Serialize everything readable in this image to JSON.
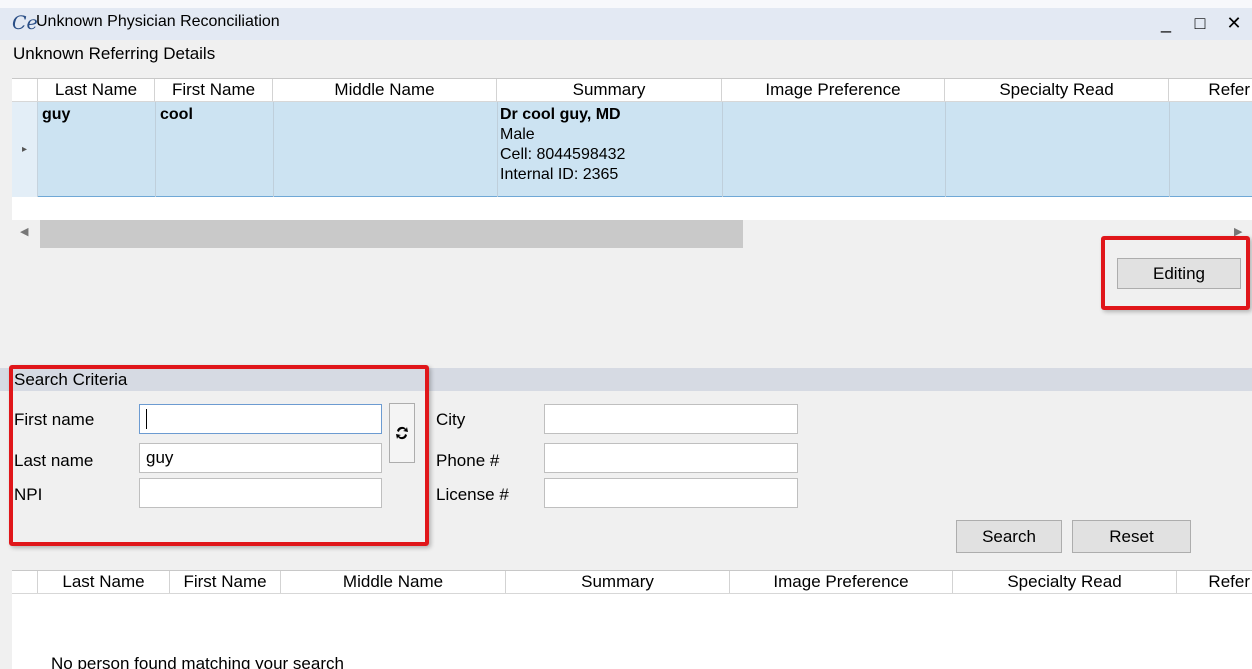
{
  "window": {
    "title": "Unknown Physician Reconciliation",
    "app_icon": "Ce",
    "minimize_label": "_",
    "maximize_label": "□",
    "close_label": "✕"
  },
  "top_section": {
    "label": "Unknown Referring Details",
    "columns": [
      "Last Name",
      "First Name",
      "Middle Name",
      "Summary",
      "Image Preference",
      "Specialty Read",
      "Refer"
    ],
    "row": {
      "last_name": "guy",
      "first_name": "cool",
      "middle_name": "",
      "summary": {
        "line1": "Dr cool guy, MD",
        "line2": "Male",
        "line3": "Cell: 8044598432",
        "line4": "Internal ID: 2365"
      },
      "image_preference": "",
      "specialty_read": ""
    },
    "editing_button": "Editing"
  },
  "search_criteria": {
    "label": "Search Criteria",
    "first_name_label": "First name",
    "first_name_value": "",
    "last_name_label": "Last name",
    "last_name_value": "guy",
    "npi_label": "NPI",
    "npi_value": "",
    "city_label": "City",
    "city_value": "",
    "phone_label": "Phone #",
    "phone_value": "",
    "license_label": "License #",
    "license_value": "",
    "search_button": "Search",
    "reset_button": "Reset",
    "swap_icon": "swap-arrows-icon"
  },
  "results": {
    "columns": [
      "Last Name",
      "First Name",
      "Middle Name",
      "Summary",
      "Image Preference",
      "Specialty Read",
      "Refer"
    ],
    "empty_message": "No person found matching your search"
  },
  "colors": {
    "highlight_box": "#e0161a",
    "selected_row": "#cce3f2",
    "titlebar": "#e3e9f3"
  }
}
